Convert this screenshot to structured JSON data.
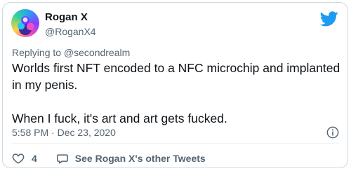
{
  "author": {
    "name": "Rogan X",
    "handle": "@RoganX4"
  },
  "reply_context": "Replying to @secondrealm",
  "tweet": {
    "line1": "Worlds first NFT encoded to a NFC microchip and implanted in my penis.",
    "line2": "When I fuck, it's art and art gets fucked."
  },
  "timestamp": "5:58 PM · Dec 23, 2020",
  "actions": {
    "like_count": "4",
    "more_tweets_label": "See Rogan X's other Tweets"
  },
  "icons": {
    "brand": "twitter-bird-icon",
    "info": "info-icon",
    "like": "heart-icon",
    "reply": "speech-bubble-icon"
  },
  "colors": {
    "brand_blue": "#1d9bf0",
    "secondary_text": "#536471",
    "primary_text": "#0f1419"
  }
}
